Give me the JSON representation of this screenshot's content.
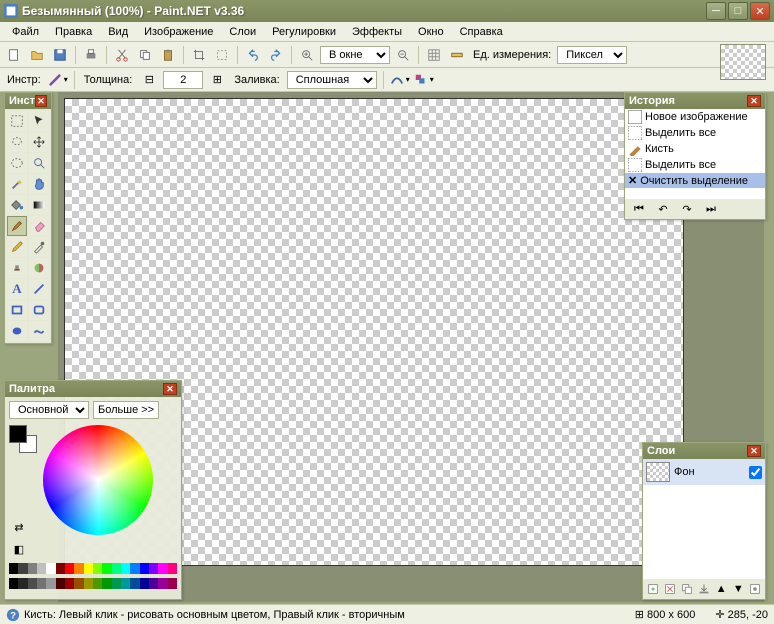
{
  "title": "Безымянный (100%) - Paint.NET v3.36",
  "menu": [
    "Файл",
    "Правка",
    "Вид",
    "Изображение",
    "Слои",
    "Регулировки",
    "Эффекты",
    "Окно",
    "Справка"
  ],
  "toolbar": {
    "zoom_label": "В окне",
    "unit_label": "Ед. измерения:",
    "unit_value": "Пиксел"
  },
  "toolbar2": {
    "instr": "Инстр:",
    "width_label": "Толщина:",
    "width_value": "2",
    "fill_label": "Заливка:",
    "fill_value": "Сплошная"
  },
  "history": {
    "title": "История",
    "items": [
      "Новое изображение",
      "Выделить все",
      "Кисть",
      "Выделить все",
      "Очистить выделение"
    ]
  },
  "tools": {
    "title": "Инст"
  },
  "layers": {
    "title": "Слои",
    "layer_name": "Фон"
  },
  "palette": {
    "title": "Палитра",
    "select_value": "Основной",
    "more_btn": "Больше >>"
  },
  "swatches": [
    "#000",
    "#404040",
    "#808080",
    "#c0c0c0",
    "#fff",
    "#800000",
    "#f00",
    "#ff8000",
    "#ff0",
    "#80ff00",
    "#0f0",
    "#00ff80",
    "#0ff",
    "#0080ff",
    "#00f",
    "#8000ff",
    "#f0f",
    "#ff0080"
  ],
  "status": {
    "text": "Кисть: Левый клик - рисовать основным цветом, Правый клик - вторичным",
    "size": "800 x 600",
    "pos": "285, -20"
  }
}
